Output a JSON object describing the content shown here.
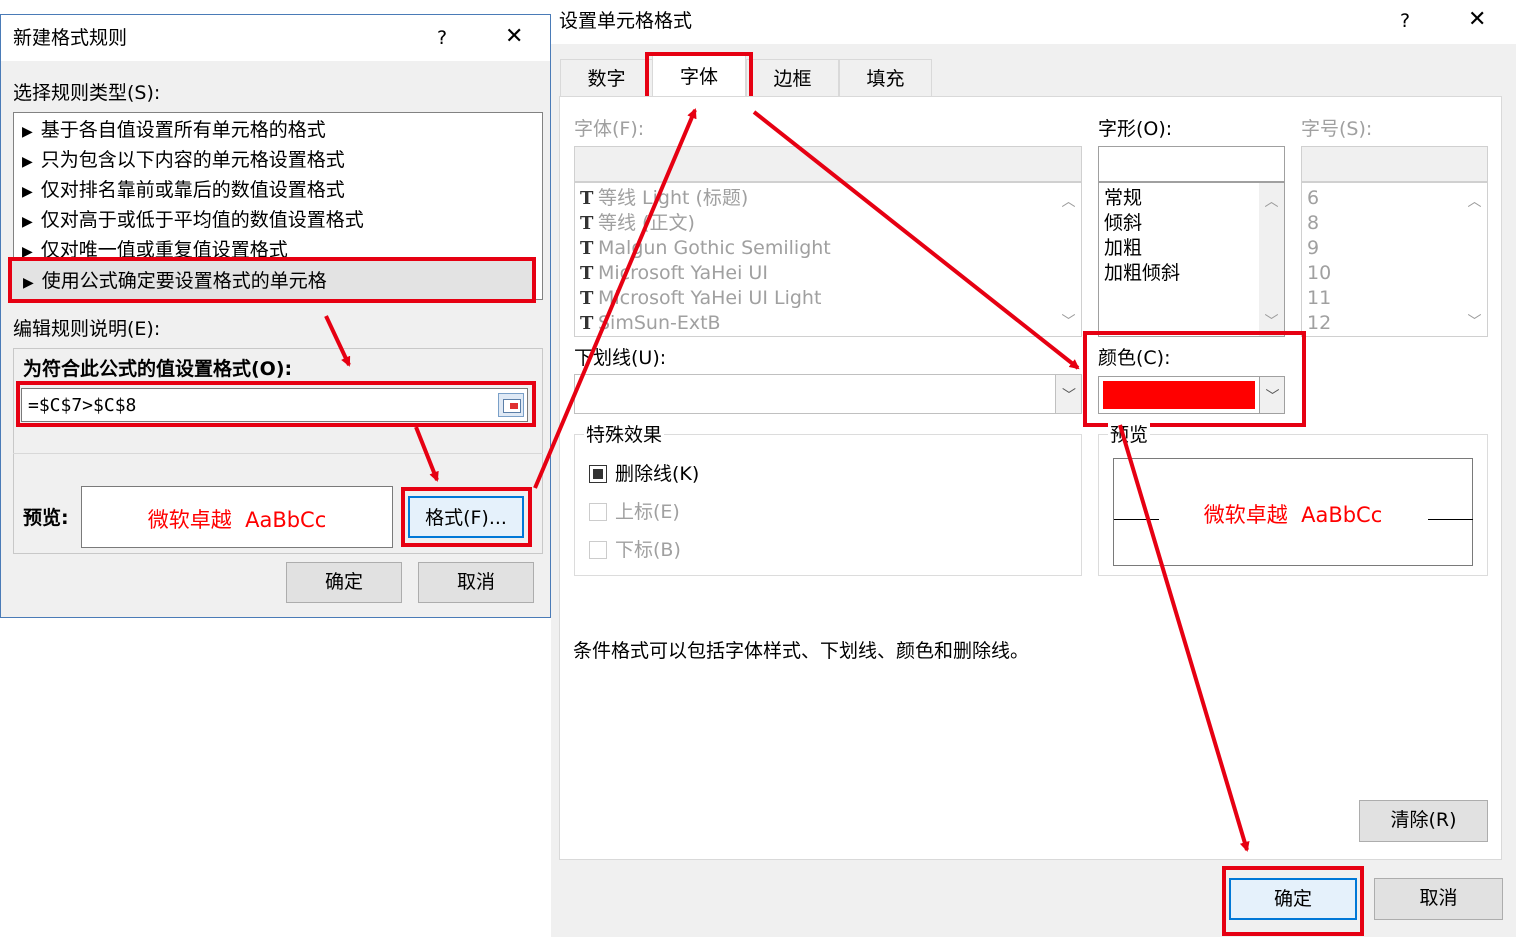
{
  "left_dialog": {
    "title": "新建格式规则",
    "help": "?",
    "close": "✕",
    "select_type_label": "选择规则类型(S):",
    "rule_types": [
      "基于各自值设置所有单元格的格式",
      "只为包含以下内容的单元格设置格式",
      "仅对排名靠前或靠后的数值设置格式",
      "仅对高于或低于平均值的数值设置格式",
      "仅对唯一值或重复值设置格式",
      "使用公式确定要设置格式的单元格"
    ],
    "rule_arrow": "▶",
    "edit_desc_label": "编辑规则说明(E):",
    "formula_label": "为符合此公式的值设置格式(O):",
    "formula_value": "=$C$7>$C$8",
    "preview_label": "预览:",
    "preview_text": "微软卓越  AaBbCc",
    "format_button": "格式(F)...",
    "ok_button": "确定",
    "cancel_button": "取消"
  },
  "right_dialog": {
    "title": "设置单元格格式",
    "help": "?",
    "close": "✕",
    "tabs": [
      "数字",
      "字体",
      "边框",
      "填充"
    ],
    "active_tab": "字体",
    "font_label": "字体(F):",
    "fonts": [
      "等线 Light (标题)",
      "等线 (正文)",
      "Malgun Gothic Semilight",
      "Microsoft YaHei UI",
      "Microsoft YaHei UI Light",
      "SimSun-ExtB"
    ],
    "style_label": "字形(O):",
    "styles": [
      "常规",
      "倾斜",
      "加粗",
      "加粗倾斜"
    ],
    "size_label": "字号(S):",
    "sizes": [
      "6",
      "8",
      "9",
      "10",
      "11",
      "12"
    ],
    "underline_label": "下划线(U):",
    "color_label": "颜色(C):",
    "color_value": "#ff0000",
    "effects_label": "特殊效果",
    "effects": [
      {
        "label": "删除线(K)",
        "checked": true,
        "enabled": true
      },
      {
        "label": "上标(E)",
        "checked": false,
        "enabled": false
      },
      {
        "label": "下标(B)",
        "checked": false,
        "enabled": false
      }
    ],
    "preview_label": "预览",
    "preview_text": "微软卓越  AaBbCc",
    "note": "条件格式可以包括字体样式、下划线、颜色和删除线。",
    "clear_button": "清除(R)",
    "ok_button": "确定",
    "cancel_button": "取消"
  },
  "colors": {
    "highlight": "#e60012",
    "preview_text": "#ff0000",
    "dialog_bg": "#f0f0f0"
  }
}
